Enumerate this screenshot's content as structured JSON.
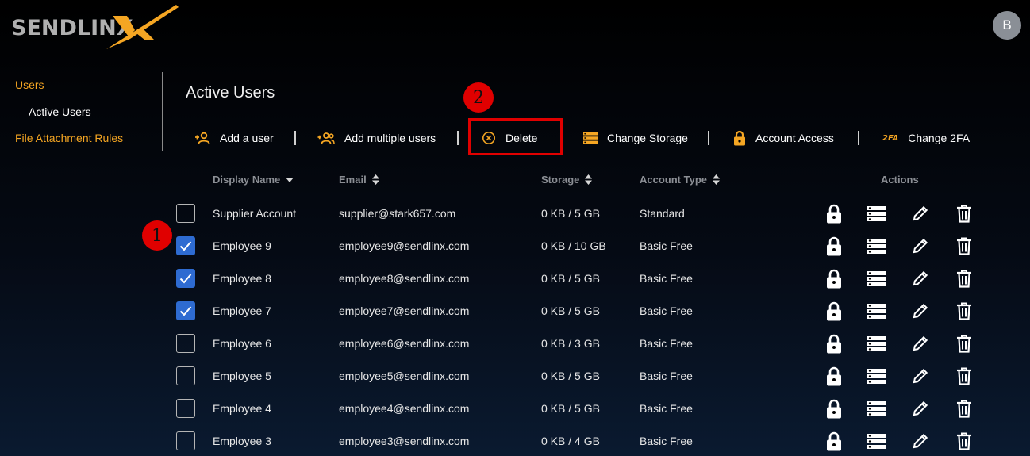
{
  "app": {
    "logo_text": "SENDLINX"
  },
  "user": {
    "avatar_initial": "B"
  },
  "sidebar": {
    "items": [
      {
        "label": "Users",
        "style": "orange"
      },
      {
        "label": "Active Users",
        "style": "white"
      },
      {
        "label": "File Attachment Rules",
        "style": "orange"
      }
    ]
  },
  "page": {
    "title": "Active Users"
  },
  "toolbar": {
    "add_user": "Add a user",
    "add_multiple": "Add multiple users",
    "delete": "Delete",
    "change_storage": "Change Storage",
    "account_access": "Account Access",
    "change_2fa": "Change 2FA",
    "twofa_icon_text": "2FA"
  },
  "annotations": {
    "step1": "1",
    "step2": "2"
  },
  "table": {
    "headers": {
      "display_name": "Display Name",
      "email": "Email",
      "storage": "Storage",
      "account_type": "Account Type",
      "actions": "Actions"
    },
    "rows": [
      {
        "checked": false,
        "name": "Supplier Account",
        "email": "supplier@stark657.com",
        "storage": "0 KB / 5 GB",
        "type": "Standard"
      },
      {
        "checked": true,
        "name": "Employee 9",
        "email": "employee9@sendlinx.com",
        "storage": "0 KB / 10 GB",
        "type": "Basic Free"
      },
      {
        "checked": true,
        "name": "Employee 8",
        "email": "employee8@sendlinx.com",
        "storage": "0 KB / 5 GB",
        "type": "Basic Free"
      },
      {
        "checked": true,
        "name": "Employee 7",
        "email": "employee7@sendlinx.com",
        "storage": "0 KB / 5 GB",
        "type": "Basic Free"
      },
      {
        "checked": false,
        "name": "Employee 6",
        "email": "employee6@sendlinx.com",
        "storage": "0 KB / 3 GB",
        "type": "Basic Free"
      },
      {
        "checked": false,
        "name": "Employee 5",
        "email": "employee5@sendlinx.com",
        "storage": "0 KB / 5 GB",
        "type": "Basic Free"
      },
      {
        "checked": false,
        "name": "Employee 4",
        "email": "employee4@sendlinx.com",
        "storage": "0 KB / 5 GB",
        "type": "Basic Free"
      },
      {
        "checked": false,
        "name": "Employee 3",
        "email": "employee3@sendlinx.com",
        "storage": "0 KB / 4 GB",
        "type": "Basic Free"
      }
    ],
    "row_actions": [
      "lock-icon",
      "storage-icon",
      "edit-icon",
      "trash-icon"
    ]
  },
  "colors": {
    "accent_orange": "#f5a623",
    "checkbox_blue": "#2e6bd1",
    "annotation_red": "#e00000"
  }
}
